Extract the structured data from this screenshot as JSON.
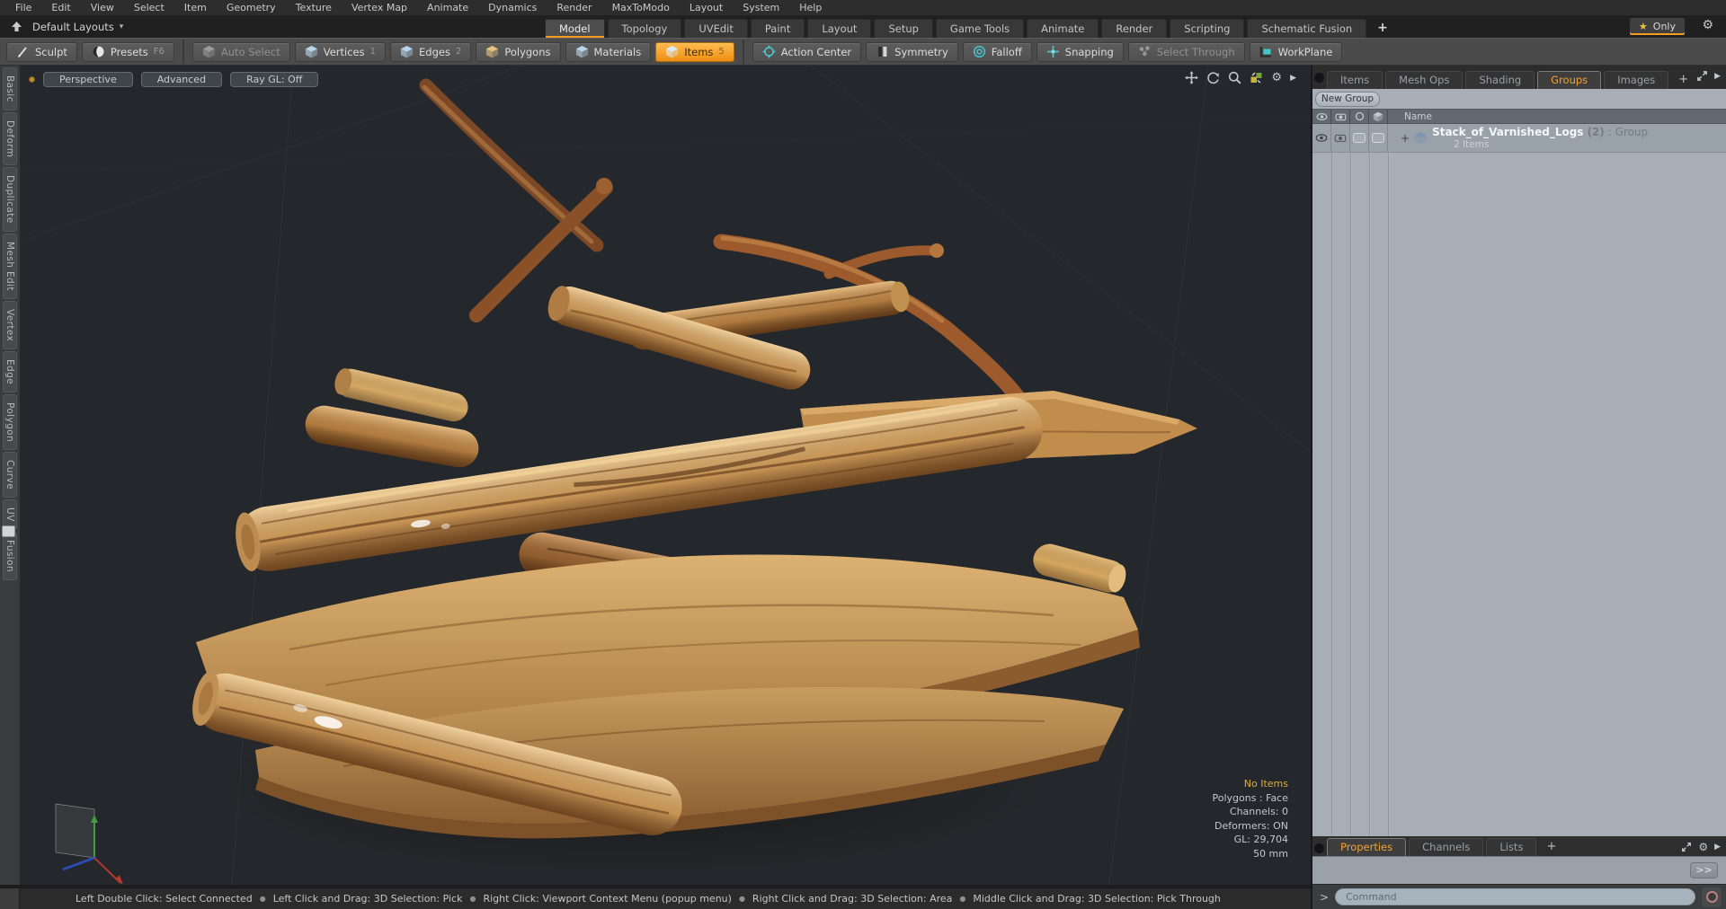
{
  "icons": {
    "gear": "⚙",
    "star": "★",
    "plus": "+",
    "dropdown": "▾",
    "play": "▶"
  },
  "menubar": {
    "items": [
      "File",
      "Edit",
      "View",
      "Select",
      "Item",
      "Geometry",
      "Texture",
      "Vertex Map",
      "Animate",
      "Dynamics",
      "Render",
      "MaxToModo",
      "Layout",
      "System",
      "Help"
    ]
  },
  "layout_bar": {
    "switcher_label": "Default Layouts",
    "tabs": [
      "Model",
      "Topology",
      "UVEdit",
      "Paint",
      "Layout",
      "Setup",
      "Game Tools",
      "Animate",
      "Render",
      "Scripting",
      "Schematic Fusion"
    ],
    "active_tab": "Model",
    "only_label": "Only"
  },
  "toolbar": {
    "sculpt": "Sculpt",
    "presets": "Presets",
    "presets_key": "F6",
    "auto_select": "Auto Select",
    "vertices": "Vertices",
    "vertices_key": "1",
    "edges": "Edges",
    "edges_key": "2",
    "polygons": "Polygons",
    "materials": "Materials",
    "items": "Items",
    "items_key": "5",
    "action_center": "Action Center",
    "symmetry": "Symmetry",
    "falloff": "Falloff",
    "snapping": "Snapping",
    "select_through": "Select Through",
    "workplane": "WorkPlane"
  },
  "left_rail": {
    "tabs": [
      "Basic",
      "Deform",
      "Duplicate",
      "Mesh Edit",
      "Vertex",
      "Edge",
      "Polygon",
      "Curve",
      "UV",
      "Fusion"
    ]
  },
  "viewport": {
    "buttons": [
      "Perspective",
      "Advanced",
      "Ray GL: Off"
    ],
    "status": {
      "selection": "No Items",
      "polygons": "Polygons : Face",
      "channels": "Channels: 0",
      "deformers": "Deformers: ON",
      "gl": "GL: 29,704",
      "focal": "50 mm"
    }
  },
  "right_panel": {
    "tabs": [
      "Items",
      "Mesh Ops",
      "Shading",
      "Groups",
      "Images"
    ],
    "active_tab": "Groups",
    "new_group": "New Group",
    "name_header": "Name",
    "group_row": {
      "expander": "+",
      "name": "Stack_of_Varnished_Logs",
      "count": "(2)",
      "type": ": Group",
      "subtext": "2 Items"
    }
  },
  "bottom_panel": {
    "tabs": [
      "Properties",
      "Channels",
      "Lists"
    ],
    "active_tab": "Properties",
    "more_label": ">>",
    "command_prompt": ">",
    "command_placeholder": "Command"
  },
  "statusbar": {
    "separator": "●",
    "segments": [
      "Left Double Click: Select Connected",
      "Left Click and Drag: 3D Selection: Pick",
      "Right Click: Viewport Context Menu (popup menu)",
      "Right Click and Drag: 3D Selection: Area",
      "Middle Click and Drag: 3D Selection: Pick Through"
    ]
  },
  "colors": {
    "accent_orange": "#f49b20",
    "selection_yellow": "#ddaf33",
    "tool_teal": "#43c6cc"
  }
}
